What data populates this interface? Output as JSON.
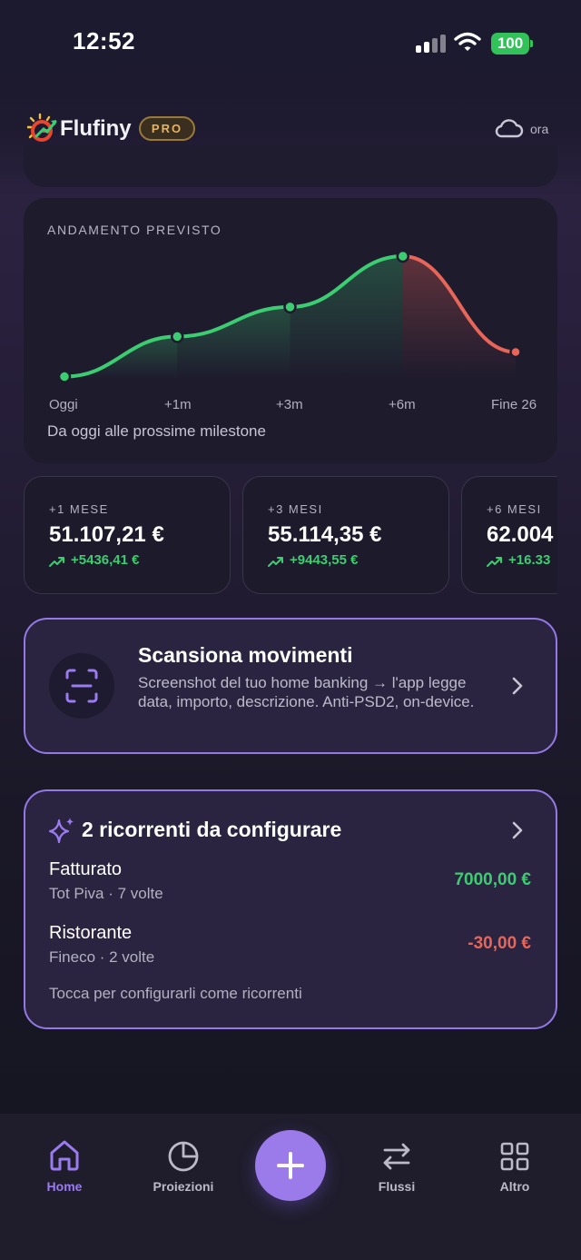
{
  "status_bar": {
    "time": "12:52",
    "battery": "100"
  },
  "header": {
    "brand": "Flufiny",
    "badge": "PRO",
    "sync_label": "ora",
    "sync_icon": "cloud-icon"
  },
  "forecast": {
    "title": "ANDAMENTO PREVISTO",
    "subtitle": "Da oggi alle prossime milestone",
    "ticks": [
      "Oggi",
      "+1m",
      "+3m",
      "+6m",
      "Fine 26"
    ],
    "colors": {
      "positive": "#3ccd72",
      "negative": "#e8655a"
    }
  },
  "chart_data": {
    "type": "area",
    "x": [
      "Oggi",
      "+1m",
      "+3m",
      "+6m",
      "Fine 26"
    ],
    "y": [
      45670.8,
      51107.21,
      55114.35,
      62004,
      49000
    ],
    "title": "ANDAMENTO PREVISTO",
    "xlabel": "",
    "ylabel": "",
    "grid": false,
    "legend": "none"
  },
  "milestones": [
    {
      "label": "+1 MESE",
      "value": "51.107,21 €",
      "delta": "+5436,41 €"
    },
    {
      "label": "+3 MESI",
      "value": "55.114,35 €",
      "delta": "+9443,55 €"
    },
    {
      "label": "+6 MESI",
      "value": "62.004",
      "delta": "+16.33"
    }
  ],
  "scan": {
    "title": "Scansiona movimenti",
    "description": "Screenshot del tuo home banking → l'app legge data, importo, descrizione. Anti-PSD2, on-device."
  },
  "recurring": {
    "title": "2 ricorrenti da configurare",
    "items": [
      {
        "name": "Fatturato",
        "meta": "Tot Piva · 7 volte",
        "amount": "7000,00 €",
        "color": "#3ccd72"
      },
      {
        "name": "Ristorante",
        "meta": "Fineco · 2 volte",
        "amount": "-30,00 €",
        "color": "#e8655a"
      }
    ],
    "hint": "Tocca per configurarli come ricorrenti"
  },
  "tabs": [
    {
      "label": "Home",
      "icon": "home-icon",
      "active": true
    },
    {
      "label": "Proiezioni",
      "icon": "pie-chart-icon",
      "active": false
    },
    {
      "label": "Flussi",
      "icon": "transfer-arrows-icon",
      "active": false
    },
    {
      "label": "Altro",
      "icon": "grid-icon",
      "active": false
    }
  ],
  "fab": {
    "icon": "plus-icon"
  }
}
